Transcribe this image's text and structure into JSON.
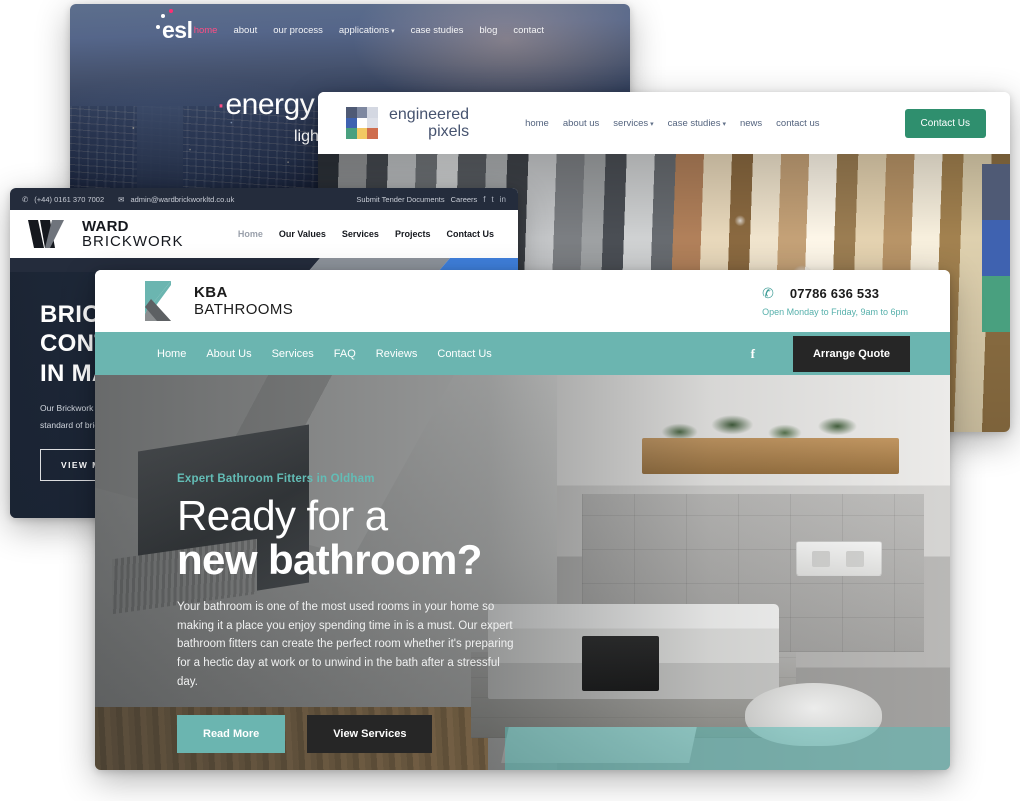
{
  "windows": {
    "esl": {
      "logo_text": "esl",
      "nav": [
        {
          "label": "home",
          "active": true
        },
        {
          "label": "about",
          "active": false
        },
        {
          "label": "our process",
          "active": false
        },
        {
          "label": "applications",
          "active": false,
          "caret": true
        },
        {
          "label": "case studies",
          "active": false
        },
        {
          "label": "blog",
          "active": false
        },
        {
          "label": "contact",
          "active": false
        }
      ],
      "hero": {
        "headline": "energy s",
        "subline": "lightin"
      }
    },
    "engineered_pixels": {
      "logo": {
        "line1": "engineered",
        "line2": "pixels",
        "tiles": [
          "#4f5a75",
          "#7e88a0",
          "#d4d8e2",
          "#3f62b0",
          "#ffffff",
          "#dde0e8",
          "#49a07f",
          "#f2c963",
          "#cf6d4d"
        ]
      },
      "nav": [
        {
          "label": "home",
          "caret": false
        },
        {
          "label": "about us",
          "caret": false
        },
        {
          "label": "services",
          "caret": true
        },
        {
          "label": "case studies",
          "caret": true
        },
        {
          "label": "news",
          "caret": false
        },
        {
          "label": "contact us",
          "caret": false
        }
      ],
      "cta_label": "Contact Us",
      "cta_color": "#2f8f6e",
      "side_bars": [
        "#4f5a75",
        "#3f62b0",
        "#49a07f"
      ]
    },
    "ward_brickwork": {
      "topbar": {
        "phone": "(+44) 0161 370 7002",
        "email": "admin@wardbrickworkltd.co.uk",
        "links": [
          "Submit Tender Documents",
          "Careers"
        ],
        "socials": [
          "f",
          "t",
          "in"
        ]
      },
      "logo": {
        "line1": "WARD",
        "line2": "BRICKWORK"
      },
      "nav": [
        {
          "label": "Home",
          "active": true
        },
        {
          "label": "Our Values",
          "active": false
        },
        {
          "label": "Services",
          "active": false
        },
        {
          "label": "Projects",
          "active": false
        },
        {
          "label": "Contact Us",
          "active": false
        }
      ],
      "hero": {
        "headline_lines": [
          "BRICK",
          "CONT",
          "IN MA"
        ],
        "body": "Our Brickwork ha operating throug a high-quality br standard of brick",
        "button_label": "VIEW MORE"
      },
      "band_colors": [
        "#242c3c",
        "#8d939b",
        "#3f7fdb"
      ]
    },
    "kba_bathrooms": {
      "logo": {
        "line1": "KBA",
        "line2": "BATHROOMS"
      },
      "contact": {
        "phone": "07786 636 533",
        "hours": "Open Monday to Friday, 9am to 6pm"
      },
      "nav": [
        {
          "label": "Home"
        },
        {
          "label": "About Us"
        },
        {
          "label": "Services"
        },
        {
          "label": "FAQ"
        },
        {
          "label": "Reviews"
        },
        {
          "label": "Contact Us"
        }
      ],
      "social_label": "f",
      "quote_button": "Arrange Quote",
      "hero": {
        "eyebrow": "Expert Bathroom Fitters in Oldham",
        "headline_line1": "Ready for a",
        "headline_line2": "new bathroom?",
        "body": "Your bathroom is one of the most used rooms in your home so making it a place you enjoy spending time in is a must. Our expert bathroom fitters can create the perfect room whether it's preparing for a hectic day at work or to unwind in the bath after a stressful day.",
        "primary_button": "Read More",
        "secondary_button": "View Services"
      },
      "accent_color": "#6bb5b0",
      "dark_color": "#262626"
    }
  }
}
